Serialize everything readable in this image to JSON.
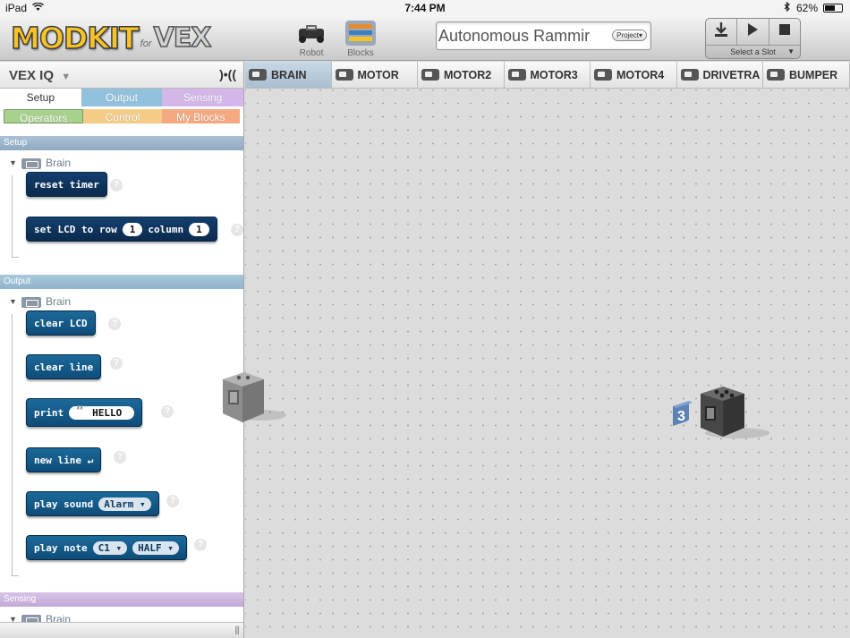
{
  "status": {
    "device": "iPad",
    "time": "7:44 PM",
    "battery": "62%",
    "battery_level": 0.62
  },
  "header": {
    "logo_main": "MODKIT",
    "logo_for": "for",
    "logo_vex": "VEX",
    "robot_label": "Robot",
    "blocks_label": "Blocks",
    "project_name": "Autonomous Rammir",
    "project_button": "Project▾",
    "slot_label": "Select a Slot",
    "slot_arrow": "▼"
  },
  "panel": {
    "title": "VEX IQ",
    "caret": "▼",
    "bluetooth": ")•((",
    "tabs": [
      "Setup",
      "Output",
      "Sensing"
    ],
    "subtabs": [
      "Operators",
      "Control",
      "My Blocks"
    ],
    "sections": {
      "setup": {
        "header": "Setup",
        "group": "Brain",
        "blocks": {
          "reset_timer": "reset timer",
          "set_lcd_prefix": "set LCD to row",
          "set_lcd_row": "1",
          "set_lcd_mid": "column",
          "set_lcd_col": "1"
        }
      },
      "output": {
        "header": "Output",
        "group": "Brain",
        "blocks": {
          "clear_lcd": "clear LCD",
          "clear_line": "clear line",
          "print": "print",
          "print_value": "HELLO",
          "new_line": "new line ↵",
          "play_sound": "play sound",
          "play_sound_value": "Alarm ▾",
          "play_note": "play note",
          "play_note_value": "C1 ▾",
          "play_note_len": "HALF ▾"
        }
      },
      "sensing": {
        "header": "Sensing",
        "group": "Brain"
      }
    },
    "help_glyph": "?",
    "grip": "|||"
  },
  "devices": [
    "BRAIN",
    "MOTOR",
    "MOTOR2",
    "MOTOR3",
    "MOTOR4",
    "DRIVETRA",
    "BUMPER"
  ],
  "canvas": {
    "port_badge": "3"
  }
}
